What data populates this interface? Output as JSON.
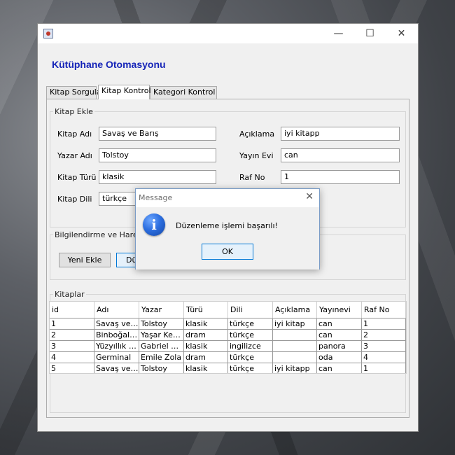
{
  "window": {
    "icon": "java-app-icon",
    "controls": {
      "minimize": "—",
      "maximize": "☐",
      "close": "✕"
    }
  },
  "app_title": "Kütüphane Otomasyonu",
  "tabs": [
    {
      "label": "Kitap Sorgula"
    },
    {
      "label": "Kitap Kontrol",
      "active": true
    },
    {
      "label": "Kategori Kontrol"
    }
  ],
  "kitap_ekle": {
    "legend": "Kitap Ekle",
    "kitap_adi": {
      "label": "Kitap Adı",
      "value": "Savaş ve Barış"
    },
    "yazar_adi": {
      "label": "Yazar Adı",
      "value": "Tolstoy"
    },
    "kitap_turu": {
      "label": "Kitap Türü",
      "value": "klasik"
    },
    "kitap_dili": {
      "label": "Kitap Dili",
      "value": "türkçe"
    },
    "aciklama": {
      "label": "Açıklama",
      "value": "iyi kitapp"
    },
    "yayin_evi": {
      "label": "Yayın Evi",
      "value": "can"
    },
    "raf_no": {
      "label": "Raf No",
      "value": "1"
    }
  },
  "bilgilendirme": {
    "legend": "Bilgilendirme ve Hareketler",
    "yeni_ekle": "Yeni Ekle",
    "duzenle": "Dü"
  },
  "kitaplar": {
    "legend": "Kitaplar",
    "columns": [
      "id",
      "Adı",
      "Yazar",
      "Türü",
      "Dili",
      "Açıklama",
      "Yayınevi",
      "Raf No"
    ],
    "rows": [
      [
        "1",
        "Savaş ve Barış",
        "Tolstoy",
        "klasik",
        "türkçe",
        "iyi kitap",
        "can",
        "1"
      ],
      [
        "2",
        "Binboğalar Efsanesi",
        "Yaşar Kemal",
        "dram",
        "türkçe",
        "",
        "can",
        "2"
      ],
      [
        "3",
        "Yüzyıllık Yalnızlık",
        "Gabriel García Márquez",
        "klasik",
        "ingilizce",
        "",
        "panora",
        "3"
      ],
      [
        "4",
        "Germinal",
        "Emile Zola",
        "dram",
        "türkçe",
        "",
        "oda",
        "4"
      ],
      [
        "5",
        "Savaş ve Barış",
        "Tolstoy",
        "klasik",
        "türkçe",
        "iyi kitapp",
        "can",
        "1"
      ]
    ]
  },
  "dialog": {
    "title": "Message",
    "close": "✕",
    "icon": "info-icon",
    "icon_glyph": "i",
    "message": "Düzenleme işlemi başarılı!",
    "ok": "OK"
  }
}
